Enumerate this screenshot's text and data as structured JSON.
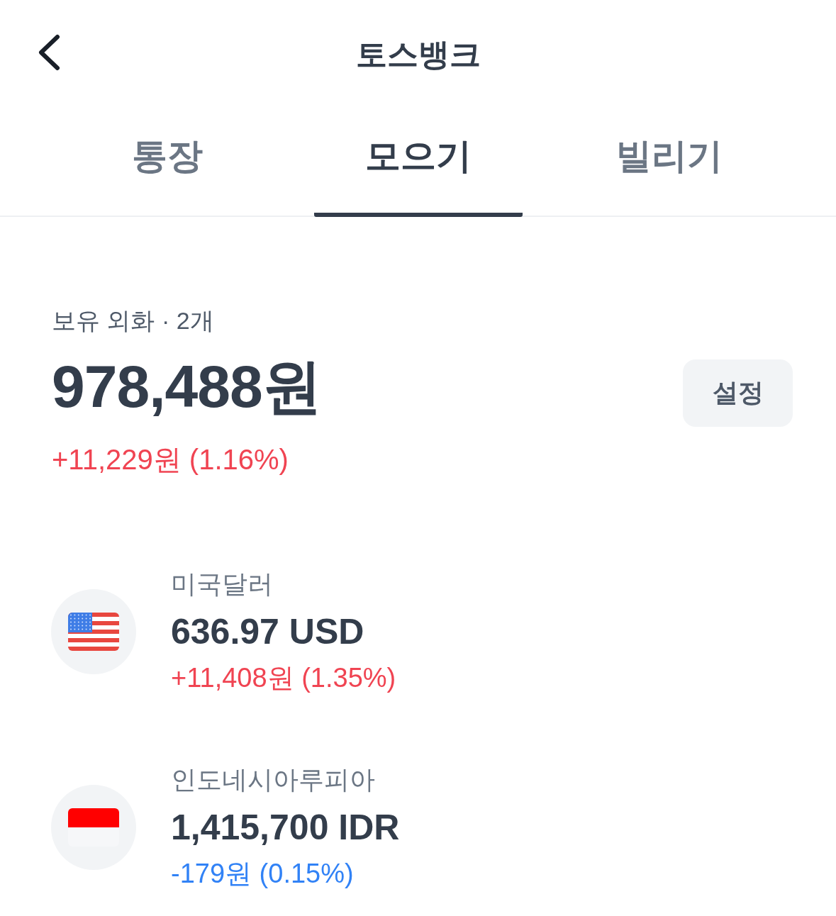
{
  "header": {
    "title": "토스뱅크"
  },
  "tabs": [
    {
      "label": "통장",
      "selected": false
    },
    {
      "label": "모으기",
      "selected": true
    },
    {
      "label": "빌리기",
      "selected": false
    }
  ],
  "summary": {
    "label": "보유 외화 · 2개",
    "total": "978,488원",
    "change": "+11,229원 (1.16%)",
    "loss": false,
    "settings_button": "설정"
  },
  "currencies": [
    {
      "kind": "us",
      "name": "미국달러",
      "amount": "636.97 USD",
      "change": "+11,408원 (1.35%)",
      "loss": false
    },
    {
      "kind": "id",
      "name": "인도네시아루피아",
      "amount": "1,415,700 IDR",
      "change": "-179원 (0.15%)",
      "loss": true
    }
  ]
}
